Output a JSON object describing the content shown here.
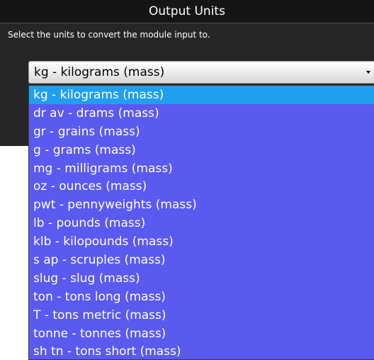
{
  "dialog": {
    "title": "Output Units",
    "instructions": "Select the units to convert the module input to."
  },
  "unit_select": {
    "selected_value": "kg - kilograms (mass)",
    "arrow_icon": "dropdown-arrow-icon",
    "options": [
      "kg - kilograms (mass)",
      "dr av - drams (mass)",
      "gr - grains (mass)",
      "g - grams (mass)",
      "mg - milligrams (mass)",
      "oz - ounces (mass)",
      "pwt - pennyweights (mass)",
      "lb - pounds (mass)",
      "klb - kilopounds (mass)",
      "s ap - scruples (mass)",
      "slug - slug (mass)",
      "ton - tons long (mass)",
      "T - tons metric (mass)",
      "tonne - tonnes (mass)",
      "sh tn - tons short (mass)"
    ],
    "highlighted_index": 0
  },
  "colors": {
    "dialog_background": "#262626",
    "title_bar_background": "#151515",
    "list_background": "#5a5af0",
    "highlight": "#1f9ff0",
    "text_on_dark": "#ffffff"
  }
}
